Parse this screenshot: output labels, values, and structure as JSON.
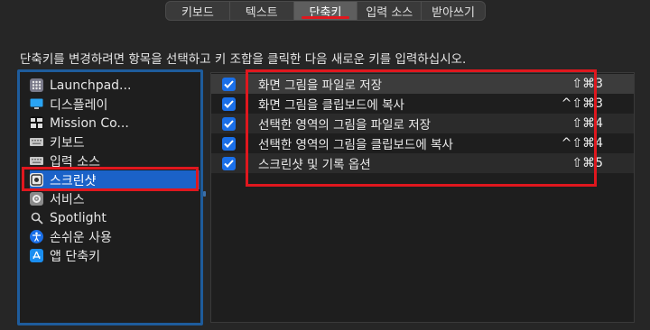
{
  "tabs": [
    {
      "label": "키보드",
      "active": false
    },
    {
      "label": "텍스트",
      "active": false
    },
    {
      "label": "단축키",
      "active": true
    },
    {
      "label": "입력 소스",
      "active": false
    },
    {
      "label": "받아쓰기",
      "active": false
    }
  ],
  "instruction": "단축키를 변경하려면 항목을 선택하고 키 조합을 클릭한 다음 새로운 키를 입력하십시오.",
  "categories": [
    {
      "label": "Launchpad...",
      "icon": "launchpad-icon"
    },
    {
      "label": "디스플레이",
      "icon": "display-icon"
    },
    {
      "label": "Mission Co...",
      "icon": "mission-control-icon"
    },
    {
      "label": "키보드",
      "icon": "keyboard-icon"
    },
    {
      "label": "입력 소스",
      "icon": "input-sources-icon"
    },
    {
      "label": "스크린샷",
      "icon": "screenshot-icon",
      "selected": true
    },
    {
      "label": "서비스",
      "icon": "gear-icon"
    },
    {
      "label": "Spotlight",
      "icon": "magnifier-icon"
    },
    {
      "label": "손쉬운 사용",
      "icon": "accessibility-icon"
    },
    {
      "label": "앱 단축키",
      "icon": "app-store-icon"
    }
  ],
  "shortcuts": [
    {
      "label": "화면 그림을 파일로 저장",
      "keys": "⇧⌘3",
      "checked": true
    },
    {
      "label": "화면 그림을 클립보드에 복사",
      "keys": "^⇧⌘3",
      "checked": true
    },
    {
      "label": "선택한 영역의 그림을 파일로 저장",
      "keys": "⇧⌘4",
      "checked": true
    },
    {
      "label": "선택한 영역의 그림을 클립보드에 복사",
      "keys": "^⇧⌘4",
      "checked": true
    },
    {
      "label": "스크린샷 및 기록 옵션",
      "keys": "⇧⌘5",
      "checked": true
    }
  ],
  "colors": {
    "accent": "#1a6fe8",
    "selection": "#1b62c8",
    "highlight_red": "#e0171e",
    "background": "#262626"
  }
}
